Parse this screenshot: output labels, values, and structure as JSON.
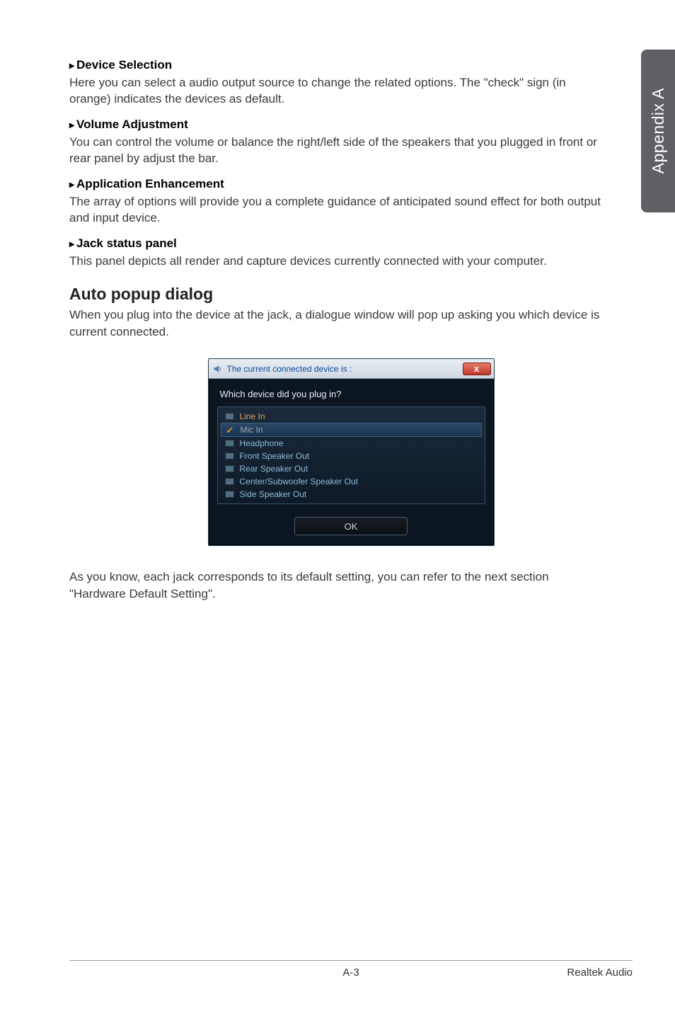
{
  "side_tab": "Appendix A",
  "sections": {
    "device_selection": {
      "title": "Device Selection",
      "body": "Here you can select a audio output source to change the related options. The \"check\" sign (in orange) indicates the devices as default."
    },
    "volume_adjustment": {
      "title": "Volume Adjustment",
      "body": "You can control the volume or balance the right/left side of the speakers that you plugged in front or rear panel by adjust the bar."
    },
    "application_enhancement": {
      "title": "Application Enhancement",
      "body": "The array of options will provide you a complete guidance of anticipated sound effect for both output and input device."
    },
    "jack_status_panel": {
      "title": "Jack status panel",
      "body": "This panel depicts all render and capture devices currently connected with your computer."
    }
  },
  "auto_popup": {
    "heading": "Auto popup dialog",
    "intro": "When you plug into the device at the jack, a dialogue window will pop up asking you which device is current connected."
  },
  "dialog": {
    "title": "The current connected device is :",
    "question": "Which device did you plug in?",
    "items": [
      {
        "label": "Line In",
        "selected": false,
        "checked": false,
        "color": "orange"
      },
      {
        "label": "Mic In",
        "selected": true,
        "checked": true,
        "color": "grey"
      },
      {
        "label": "Headphone",
        "selected": false,
        "checked": false,
        "color": "normal"
      },
      {
        "label": "Front Speaker Out",
        "selected": false,
        "checked": false,
        "color": "normal"
      },
      {
        "label": "Rear Speaker Out",
        "selected": false,
        "checked": false,
        "color": "normal"
      },
      {
        "label": "Center/Subwoofer Speaker Out",
        "selected": false,
        "checked": false,
        "color": "normal"
      },
      {
        "label": "Side Speaker Out",
        "selected": false,
        "checked": false,
        "color": "normal"
      }
    ],
    "ok": "OK",
    "close": "x"
  },
  "after_dialog": "As you know, each jack corresponds to its default setting, you can refer to the next section \"Hardware Default Setting\".",
  "footer": {
    "center": "A-3",
    "right": "Realtek Audio"
  },
  "bullet": "▸"
}
